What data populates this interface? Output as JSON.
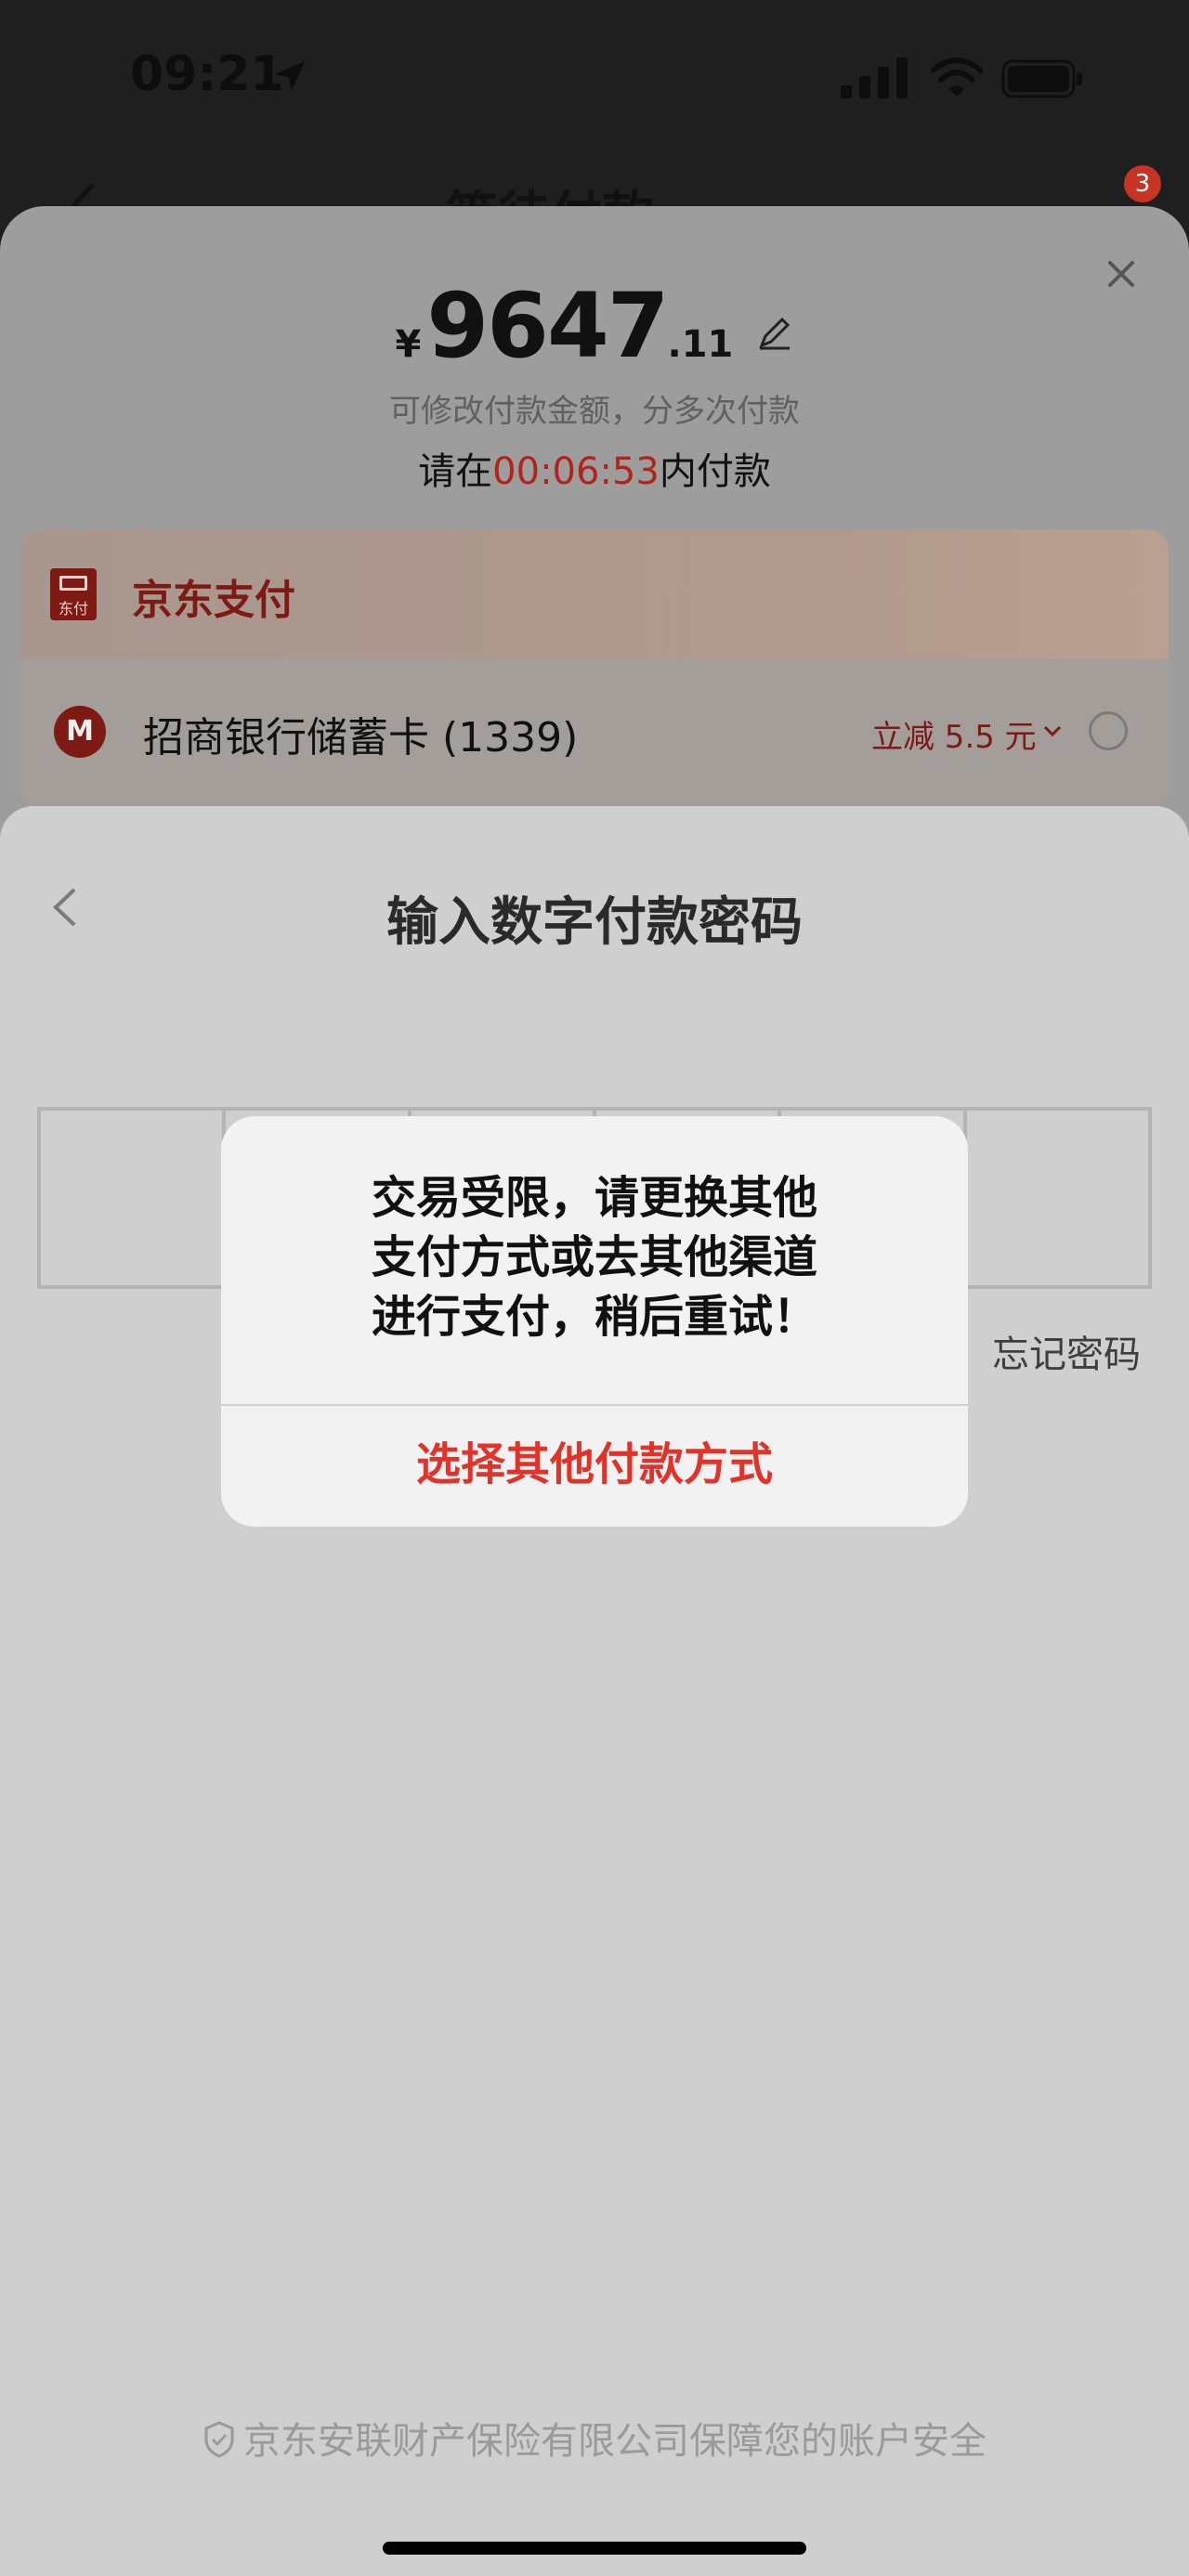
{
  "status_bar": {
    "time": "09:21"
  },
  "order_header": {
    "title": "等待付款",
    "badge": "3"
  },
  "payment": {
    "currency": "¥",
    "amount_int": "9647",
    "amount_dec": ".11",
    "hint": "可修改付款金额，分多次付款",
    "countdown_prefix": "请在",
    "countdown_time": "00:06:53",
    "countdown_suffix": "内付款",
    "jd_pay": {
      "title": "京东支付",
      "logo_text": "东付"
    },
    "bank": {
      "name": "招商银行储蓄卡 (1339)",
      "discount": "立减 5.5 元",
      "logo_text": "M"
    }
  },
  "password_sheet": {
    "title": "输入数字付款密码",
    "digits": 6,
    "forgot": "忘记密码",
    "insurance": "京东安联财产保险有限公司保障您的账户安全"
  },
  "alert": {
    "line1": "交易受限，请更换其他",
    "line2": "支付方式或去其他渠道",
    "line3": "进行支付，稍后重试！",
    "action": "选择其他付款方式"
  },
  "icons": [
    "location-arrow-icon",
    "signal-icon",
    "wifi-icon",
    "battery-icon",
    "back-chevron-icon",
    "close-icon",
    "edit-icon",
    "chevron-down-icon",
    "shield-icon"
  ],
  "colors": {
    "accent_red": "#e2332a",
    "jd_red": "#7e1a14",
    "countdown_red": "#b3231a"
  }
}
